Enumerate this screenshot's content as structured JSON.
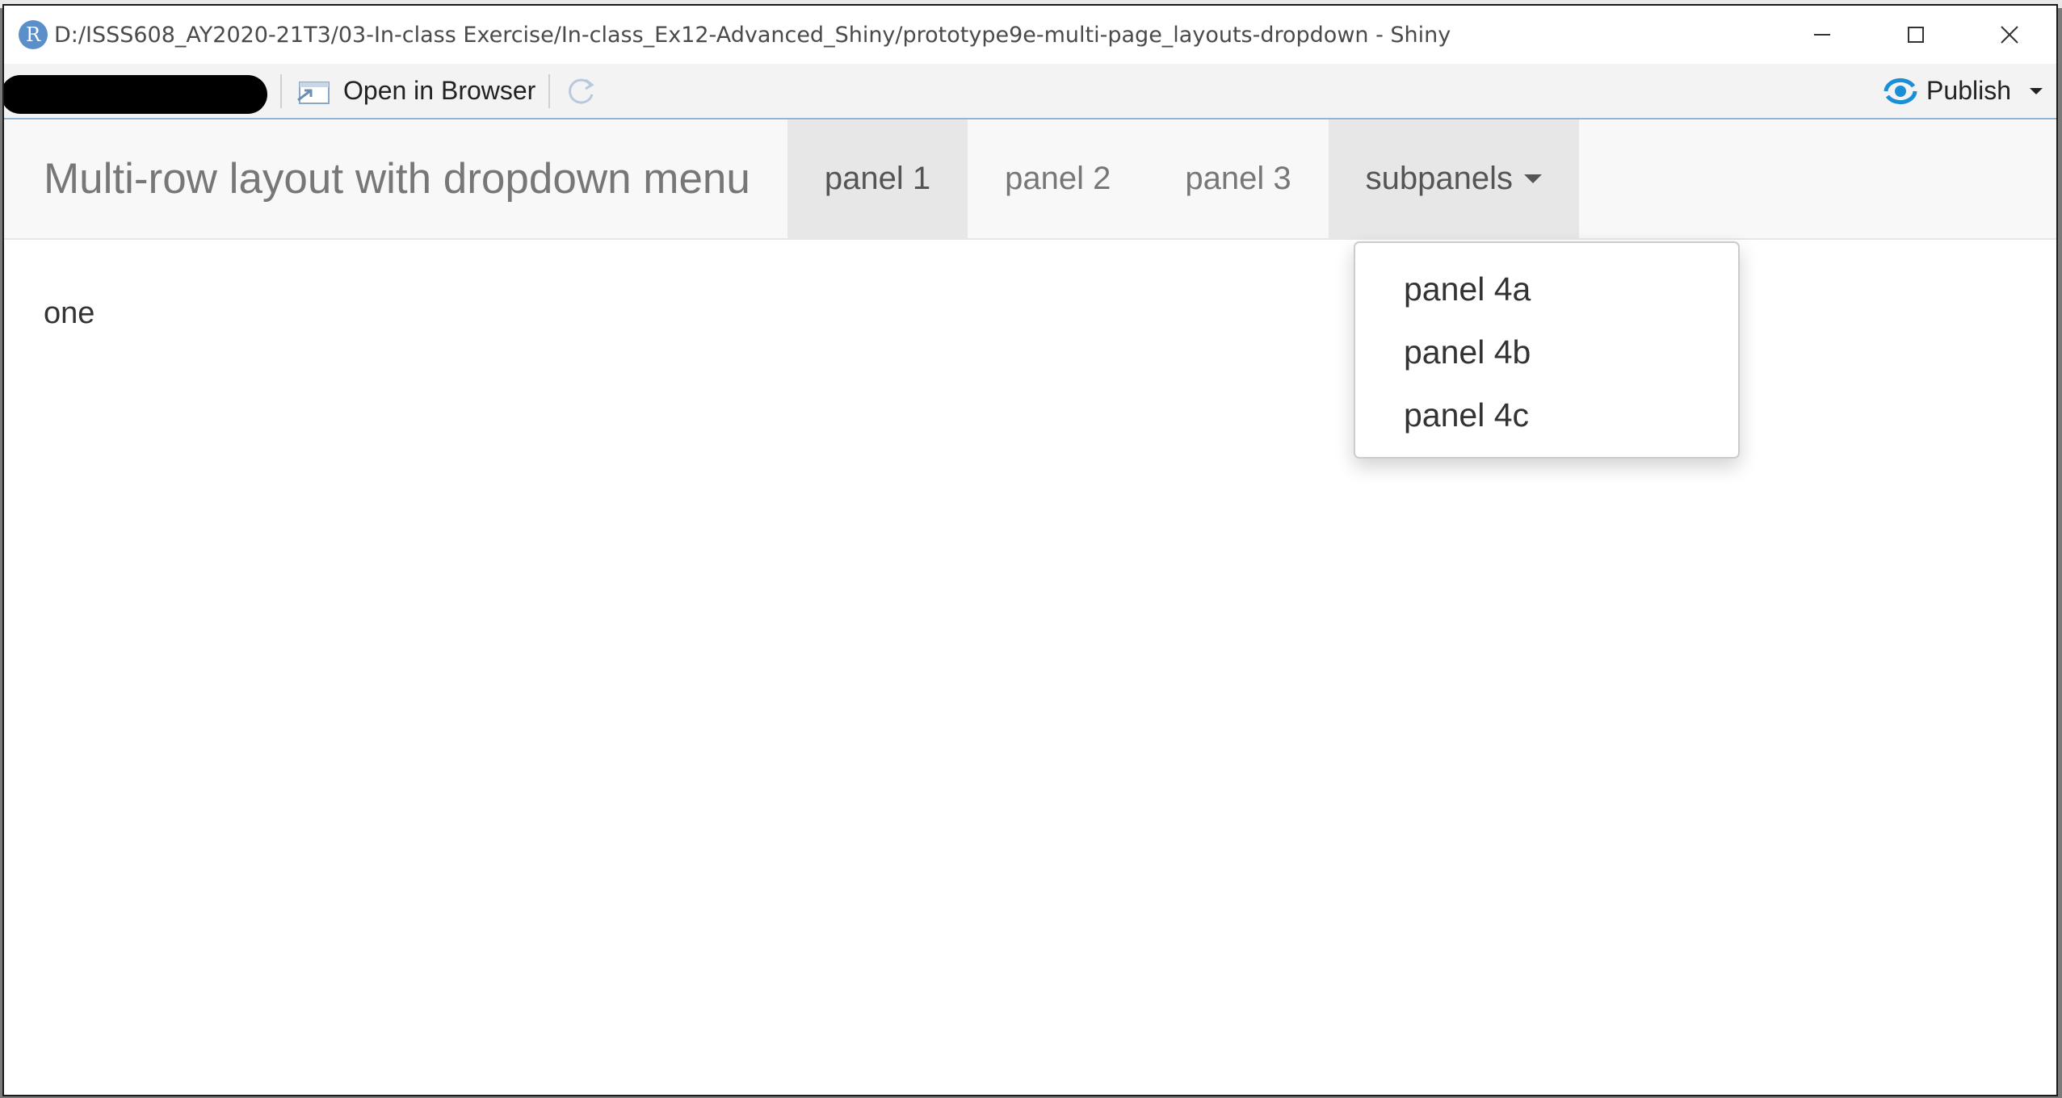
{
  "window": {
    "title": "D:/ISSS608_AY2020-21T3/03-In-class Exercise/In-class_Ex12-Advanced_Shiny/prototype9e-multi-page_layouts-dropdown - Shiny",
    "logo_letter": "R"
  },
  "toolbar": {
    "open_in_browser": "Open in Browser",
    "publish": "Publish"
  },
  "navbar": {
    "brand": "Multi-row layout with dropdown menu",
    "tabs": [
      {
        "label": "panel 1",
        "active": true
      },
      {
        "label": "panel 2",
        "active": false
      },
      {
        "label": "panel 3",
        "active": false
      },
      {
        "label": "subpanels",
        "active": true,
        "dropdown": true
      }
    ]
  },
  "dropdown": {
    "items": [
      "panel 4a",
      "panel 4b",
      "panel 4c"
    ]
  },
  "main": {
    "content_text": "one"
  },
  "colors": {
    "navbar_bg": "#f8f8f8",
    "active_tab_bg": "#e7e7e7",
    "r_logo": "#5b8fc9",
    "publish_icon": "#1a8fd6"
  }
}
